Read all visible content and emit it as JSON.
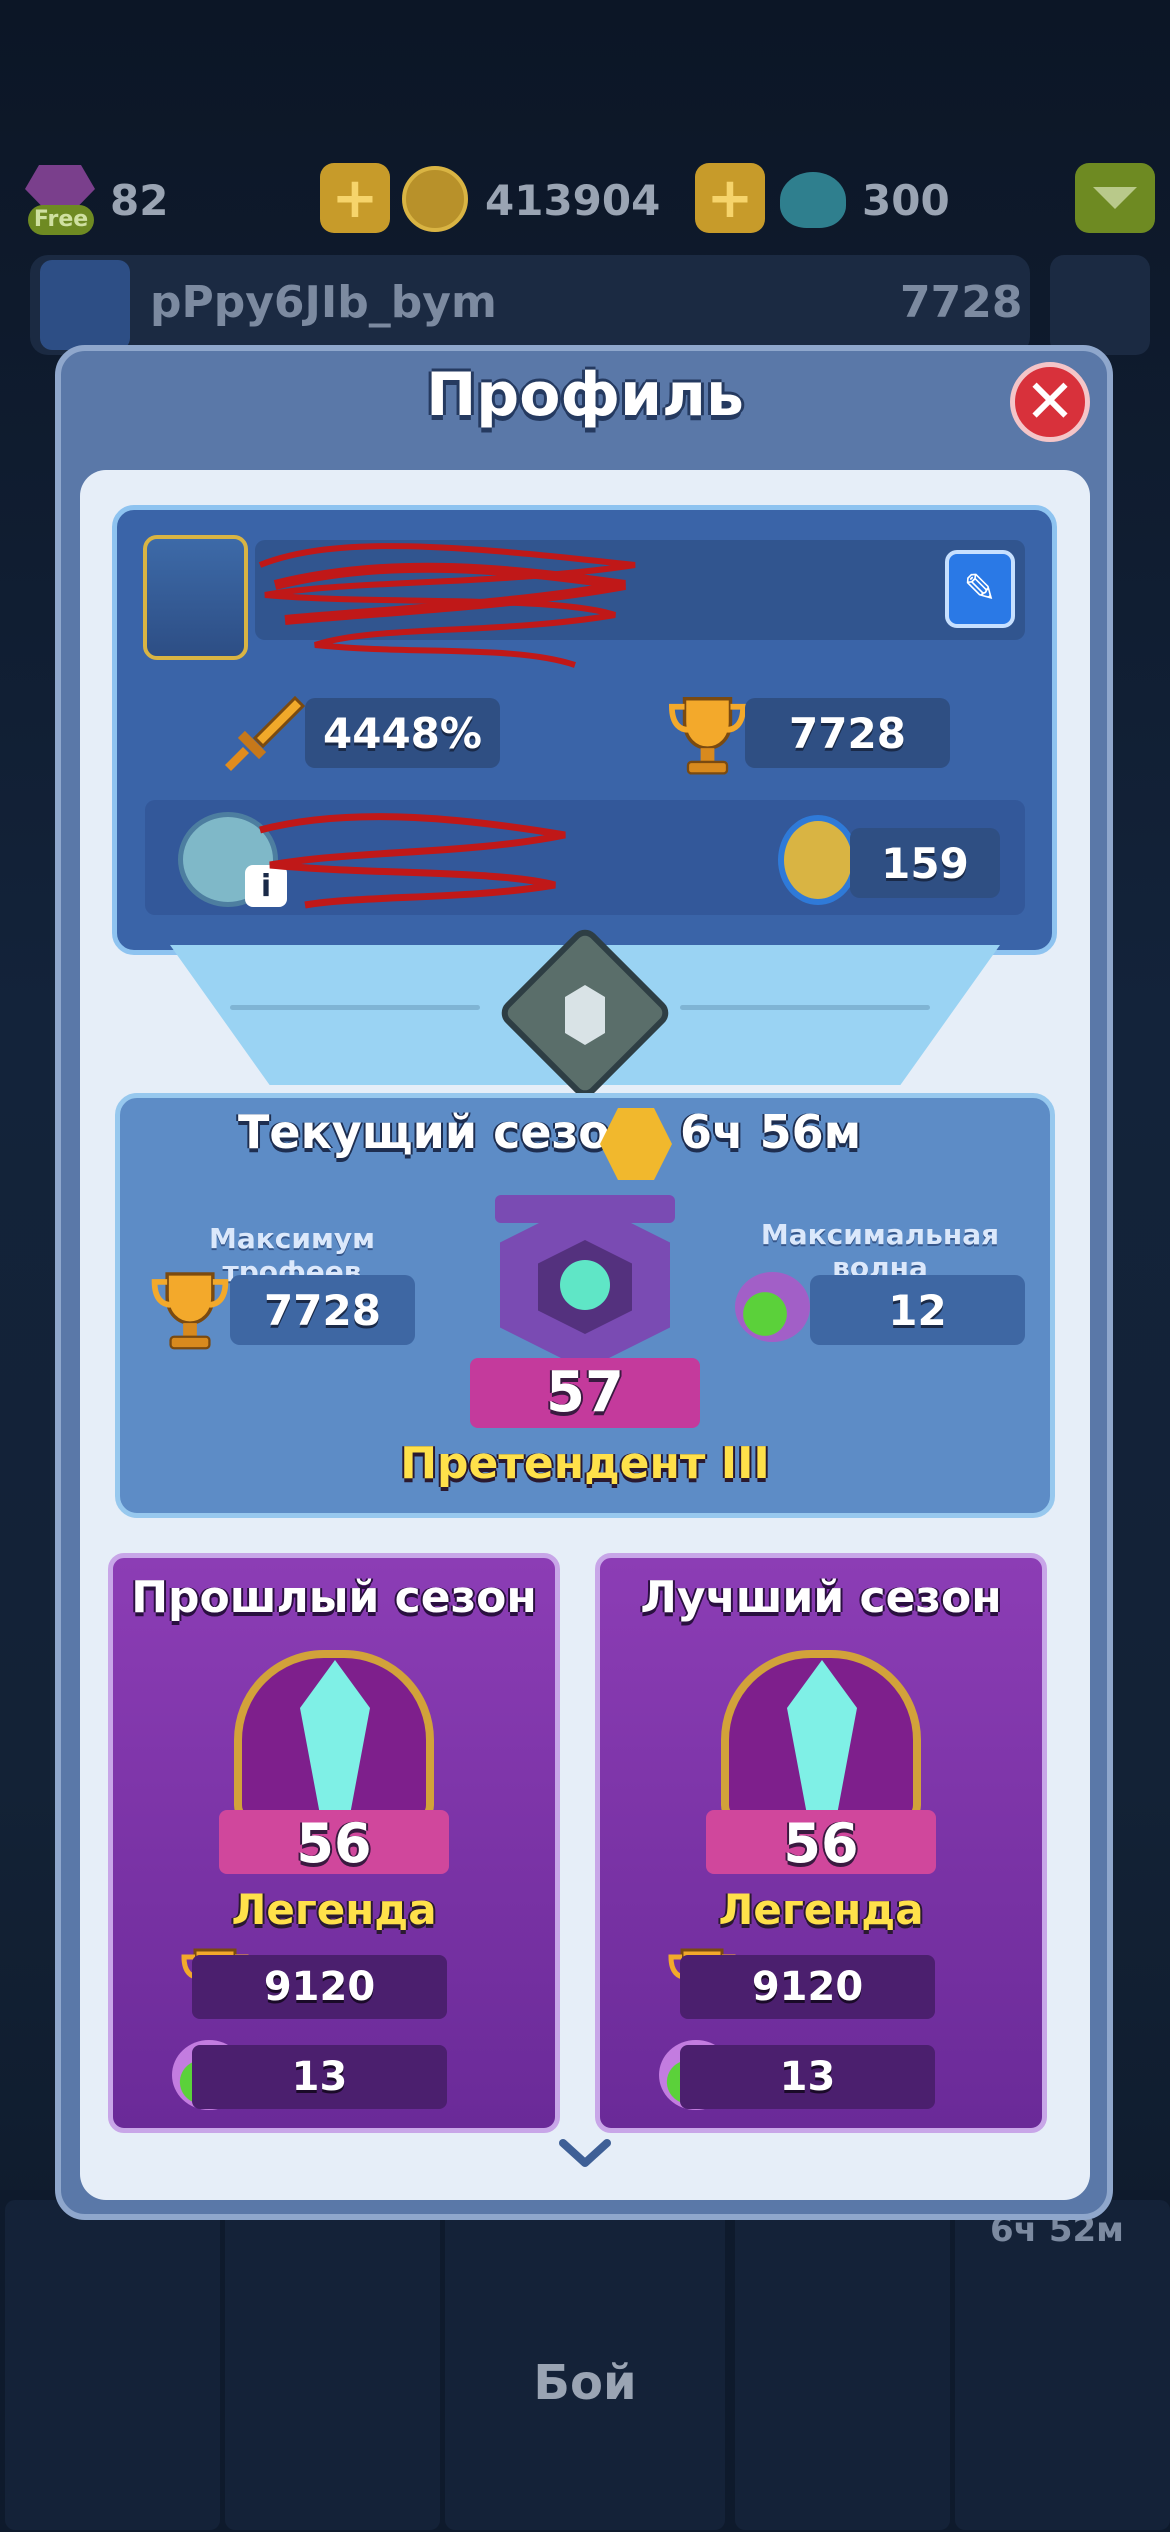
{
  "top_bar": {
    "free_badge": "Free",
    "gems": "82",
    "coins": "413904",
    "slime": "300"
  },
  "bg_profile": {
    "name": "pPpy6JIb_bym",
    "trophies": "7728"
  },
  "modal": {
    "title": "Профиль",
    "profile": {
      "damage_bonus": "4448%",
      "trophies": "7728",
      "medals": "159"
    },
    "current_season": {
      "label": "Текущий сезон:",
      "timer": "6ч 56м",
      "max_trophies_label": "Максимум трофеев",
      "max_trophies": "7728",
      "max_wave_label": "Максимальная волна",
      "max_wave": "12",
      "rank_level": "57",
      "rank_name": "Претендент III"
    },
    "past_season": {
      "title": "Прошлый сезон",
      "rank_level": "56",
      "rank_name": "Легенда",
      "trophies": "9120",
      "wave": "13"
    },
    "best_season": {
      "title": "Лучший сезон",
      "rank_level": "56",
      "rank_name": "Легенда",
      "trophies": "9120",
      "wave": "13"
    }
  },
  "bottom_nav": {
    "battle_label": "Бой",
    "timer": "6ч 52м"
  },
  "colors": {
    "accent_gold": "#ffe14a",
    "close_red": "#d8313b",
    "edit_blue": "#2a79e6",
    "season_purple": "#8c3db5"
  }
}
